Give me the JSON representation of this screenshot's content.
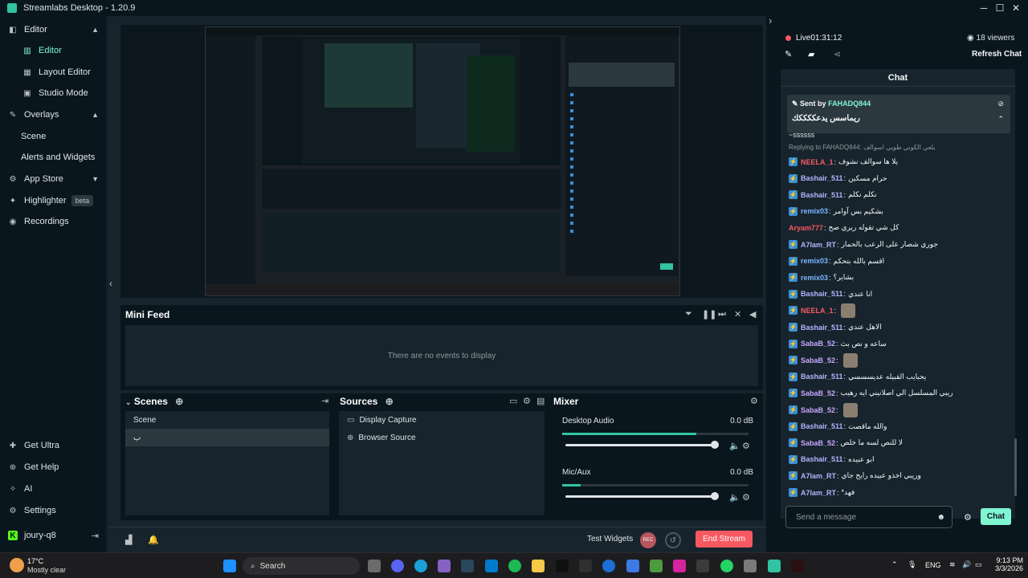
{
  "window": {
    "title": "Streamlabs Desktop - 1.20.9",
    "minimize": "─",
    "maximize": "☐",
    "close": "✕"
  },
  "sidebar": {
    "items": [
      {
        "label": "Editor",
        "icon": "editor-icon",
        "glyph": "◧"
      },
      {
        "label": "Editor",
        "icon": "editor-sub-icon",
        "glyph": "▥"
      },
      {
        "label": "Layout Editor",
        "icon": "layout-icon",
        "glyph": "▦"
      },
      {
        "label": "Studio Mode",
        "icon": "studio-icon",
        "glyph": "▣"
      },
      {
        "label": "Overlays",
        "icon": "overlays-icon",
        "glyph": "✎"
      },
      {
        "label": "Scene",
        "icon": "",
        "glyph": ""
      },
      {
        "label": "Alerts and Widgets",
        "icon": "",
        "glyph": ""
      },
      {
        "label": "App Store",
        "icon": "appstore-icon",
        "glyph": "⚙"
      },
      {
        "label": "Highlighter",
        "icon": "highlighter-icon",
        "glyph": "✦",
        "badge": "beta"
      },
      {
        "label": "Recordings",
        "icon": "recordings-icon",
        "glyph": "◉"
      }
    ],
    "bottom": [
      {
        "label": "Get Ultra",
        "icon": "ultra-icon",
        "glyph": "✚"
      },
      {
        "label": "Get Help",
        "icon": "help-icon",
        "glyph": "⊕"
      },
      {
        "label": "AI",
        "icon": "ai-icon",
        "glyph": "✧"
      },
      {
        "label": "Settings",
        "icon": "settings-icon",
        "glyph": "⚙"
      },
      {
        "label": "joury-q8",
        "icon": "kick-icon",
        "glyph": "K"
      }
    ]
  },
  "minifeed": {
    "title": "Mini Feed",
    "empty": "There are no events to display"
  },
  "scenes": {
    "title": "Scenes",
    "header": "Scene",
    "items": [
      "ب"
    ]
  },
  "sources": {
    "title": "Sources",
    "items": [
      {
        "label": "Display Capture",
        "glyph": "▭"
      },
      {
        "label": "Browser Source",
        "glyph": "⊕"
      }
    ]
  },
  "mixer": {
    "title": "Mixer",
    "channels": [
      {
        "name": "Desktop Audio",
        "db": "0.0 dB",
        "level": 0.72,
        "volume": 1.0
      },
      {
        "name": "Mic/Aux",
        "db": "0.0 dB",
        "level": 0.1,
        "volume": 1.0
      }
    ]
  },
  "footer": {
    "test_widgets": "Test Widgets",
    "rec": "REC",
    "end_stream": "End Stream"
  },
  "live": {
    "status": "Live",
    "time": "01:31:12",
    "viewers": "18 viewers",
    "refresh": "Refresh Chat"
  },
  "chat": {
    "title": "Chat",
    "pinned": {
      "by_label": "Sent by",
      "by_user": "FAHADQ844",
      "text": "ريماسس يدعككككك"
    },
    "partial": "~ssssss",
    "reply_line": "Replying to FAHADQ844: يلعي الكوني طويي اسوالف",
    "messages": [
      {
        "user": "NEELA_1",
        "color": "#f85961",
        "text": "يلا ها سوالف نشوف"
      },
      {
        "user": "Bashair_511",
        "color": "#b0b6ff",
        "text": "حرام مسكين"
      },
      {
        "user": "Bashair_511",
        "color": "#b0b6ff",
        "text": "نكلم نكلم"
      },
      {
        "user": "remix03",
        "color": "#7ab6ff",
        "text": "بشكيم بس آوامر"
      },
      {
        "user": "Aryam777",
        "color": "#f85961",
        "text": "كل شي تقوله ريري صح",
        "nobadge": true
      },
      {
        "user": "A7lam_RT",
        "color": "#b0b6ff",
        "text": "جوري شصار على الرعب بالحمار"
      },
      {
        "user": "remix03",
        "color": "#7ab6ff",
        "text": "اقسم بالله بتحكم"
      },
      {
        "user": "remix03",
        "color": "#7ab6ff",
        "text": "بشاير؟"
      },
      {
        "user": "Bashair_511",
        "color": "#b0b6ff",
        "text": "انا عندي"
      },
      {
        "user": "NEELA_1",
        "color": "#f85961",
        "text": "",
        "emote": true
      },
      {
        "user": "Bashair_511",
        "color": "#b0b6ff",
        "text": "الاهل عندي"
      },
      {
        "user": "SabaB_52",
        "color": "#c9a6ff",
        "text": "ساعه و نص بث"
      },
      {
        "user": "SabaB_52",
        "color": "#c9a6ff",
        "text": "",
        "emote": true
      },
      {
        "user": "Bashair_511",
        "color": "#b0b6ff",
        "text": "يحبايب القبيله عديسسسي"
      },
      {
        "user": "SabaB_52",
        "color": "#c9a6ff",
        "text": "ريبي المسلسل الي اصلانيني ايه رهيب"
      },
      {
        "user": "SabaB_52",
        "color": "#c9a6ff",
        "text": "",
        "emote": true
      },
      {
        "user": "Bashair_511",
        "color": "#b0b6ff",
        "text": "والله ماقصت"
      },
      {
        "user": "SabaB_52",
        "color": "#c9a6ff",
        "text": "لا للنص لسه ما خلص"
      },
      {
        "user": "Bashair_511",
        "color": "#b0b6ff",
        "text": "ابو عبيده"
      },
      {
        "user": "A7lam_RT",
        "color": "#b0b6ff",
        "text": "وريبي اخذو عبيده رايح جاي"
      },
      {
        "user": "A7lam_RT",
        "color": "#b0b6ff",
        "text": "*فهد"
      }
    ],
    "input_placeholder": "Send a message",
    "send": "Chat"
  },
  "taskbar": {
    "weather_temp": "17°C",
    "weather_desc": "Mostly clear",
    "search": "Search",
    "lang": "ENG",
    "time": "9:13 PM",
    "date": "3/3/2026"
  },
  "colors": {
    "accent": "#80f5d2",
    "live": "#f85961",
    "bg": "#09161d",
    "panel": "#17242d"
  }
}
